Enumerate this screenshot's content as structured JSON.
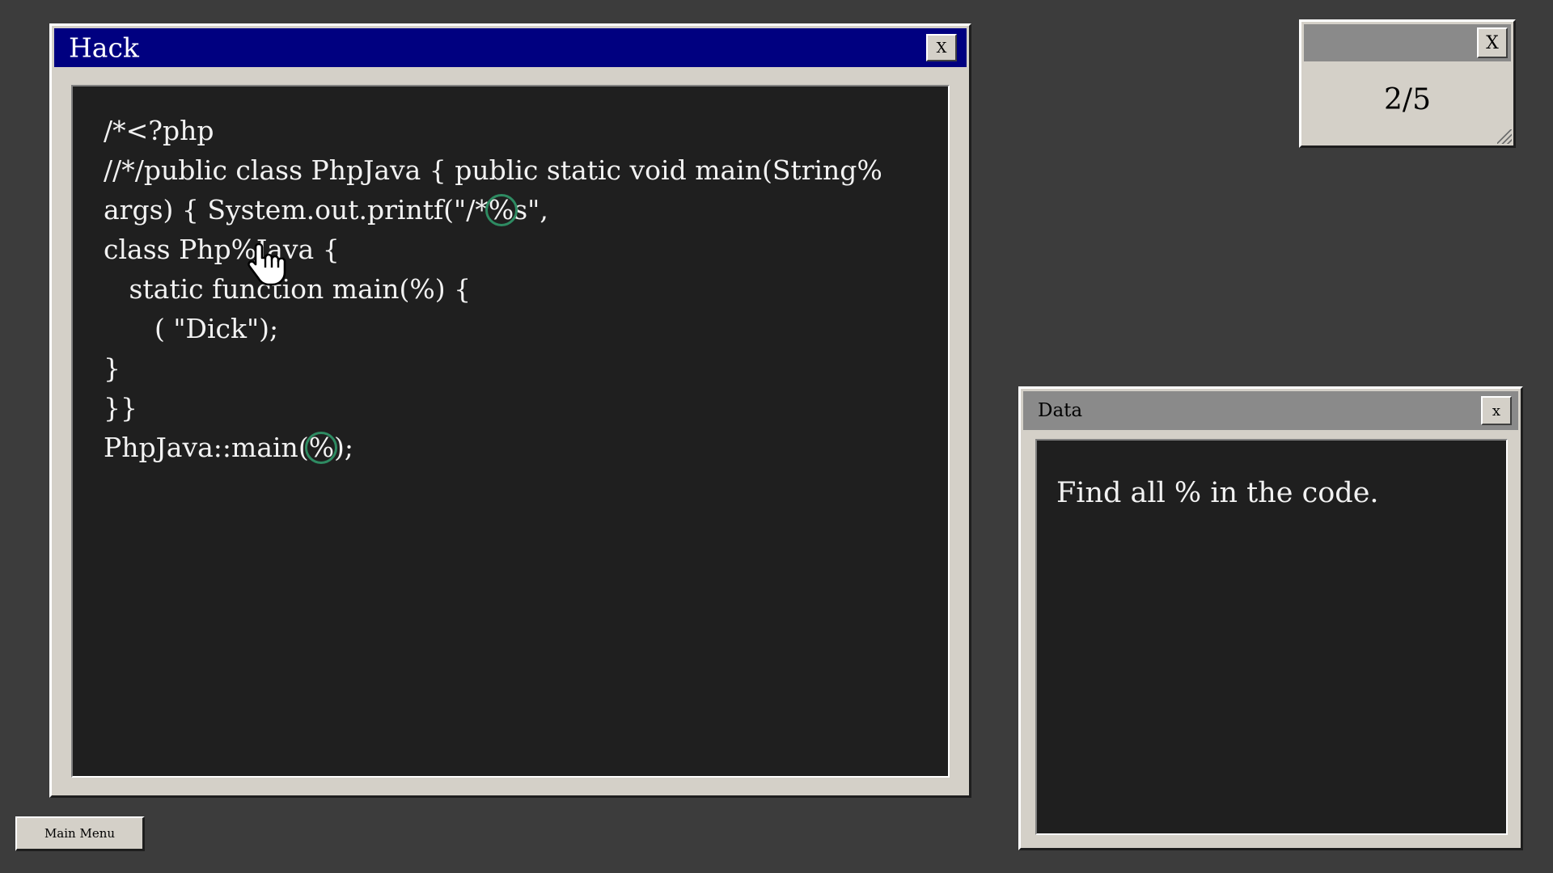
{
  "hack_window": {
    "title": "Hack",
    "close_label": "X",
    "code_lines": [
      {
        "indent": "",
        "segments": [
          {
            "text": "/*<?php"
          }
        ]
      },
      {
        "indent": "",
        "segments": [
          {
            "text": "//*/public class PhpJava { public static void main(String"
          },
          {
            "pct": "%",
            "found": false
          }
        ]
      },
      {
        "indent": "",
        "segments": [
          {
            "text": "args) { System.out.printf(\"/*"
          },
          {
            "pct": "%",
            "found": true
          },
          {
            "text": "s\","
          }
        ]
      },
      {
        "indent": "",
        "segments": [
          {
            "text": "class Php"
          },
          {
            "pct": "%",
            "found": false
          },
          {
            "text": "Java {"
          }
        ]
      },
      {
        "indent": "   ",
        "segments": [
          {
            "text": "static function main("
          },
          {
            "pct": "%",
            "found": false
          },
          {
            "text": ") {"
          }
        ]
      },
      {
        "indent": "      ",
        "segments": [
          {
            "text": "( \"Dick\");"
          }
        ]
      },
      {
        "indent": "",
        "segments": [
          {
            "text": "}"
          }
        ]
      },
      {
        "indent": "",
        "segments": [
          {
            "text": "}}"
          }
        ]
      },
      {
        "indent": "",
        "segments": [
          {
            "text": "PhpJava::main("
          },
          {
            "pct": "%",
            "found": true
          },
          {
            "text": ");"
          }
        ]
      }
    ]
  },
  "counter_window": {
    "close_label": "X",
    "progress_text": "2/5"
  },
  "data_window": {
    "title": "Data",
    "close_label": "x",
    "instruction": "Find all % in the code."
  },
  "main_menu": {
    "label": "Main Menu"
  },
  "colors": {
    "desktop_background": "#3c3c3c",
    "window_face": "#d4d0c8",
    "active_titlebar": "#000080",
    "inactive_titlebar": "#8a8a8a",
    "code_background": "#1f1f1f",
    "found_marker": "#2e8b62"
  },
  "icons": {
    "cursor": "hand-pointer-icon",
    "resize": "resize-grip-icon"
  }
}
